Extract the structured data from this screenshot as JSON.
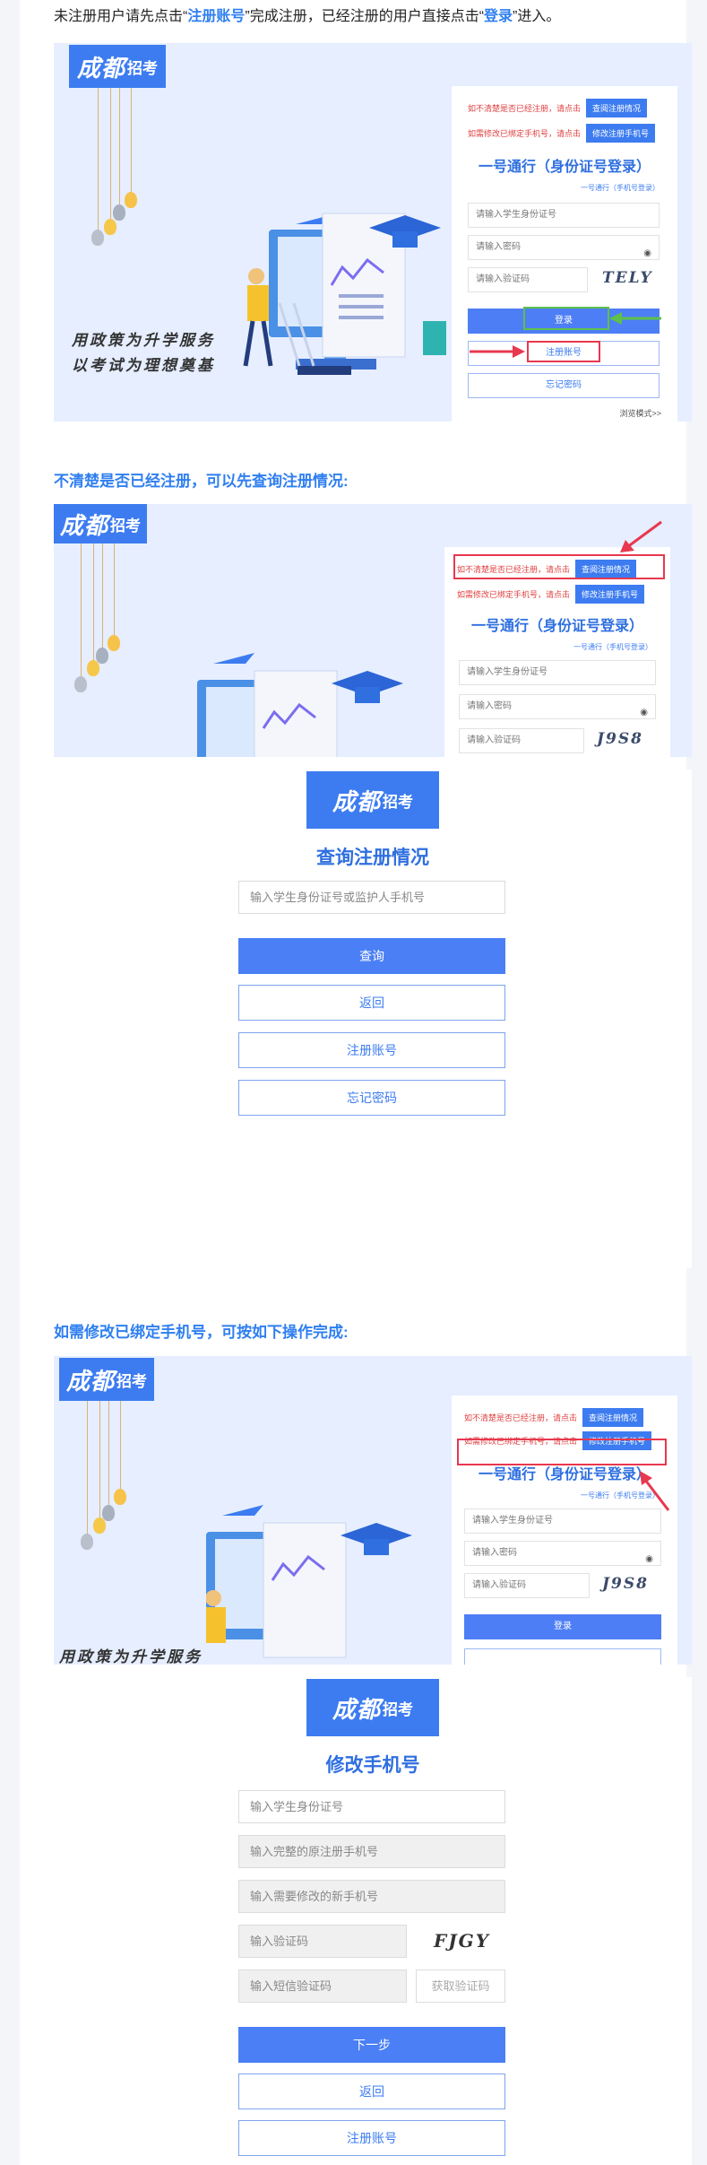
{
  "intro": {
    "before": "未注册用户请先点击“",
    "register": "注册账号",
    "middle": "”完成注册，已经注册的用户直接点击“",
    "login": "登录",
    "after": "”进入。"
  },
  "section2_heading": "不清楚是否已经注册，可以先查询注册情况:",
  "section3_heading": "如需修改已绑定手机号，可按如下操作完成:",
  "logo": {
    "big": "成都",
    "small": "招考"
  },
  "slogan": [
    "用政策为升学服务",
    "以考试为理想奠基"
  ],
  "slogan_partial": "用政策为升学服务",
  "panel": {
    "check_hint": "如不清楚是否已经注册，请点击",
    "check_btn": "查阅注册情况",
    "phone_hint": "如需修改已绑定手机号，请点击",
    "phone_btn": "修改注册手机号",
    "title": "一号通行（身份证号登录）",
    "sub_link": "一号通行（手机号登录）",
    "id_placeholder": "请输入学生身份证号",
    "pwd_placeholder": "请输入密码",
    "code_placeholder": "请输入验证码",
    "login_btn": "登录",
    "register_btn": "注册账号",
    "forgot_btn": "忘记密码",
    "browse_mode": "浏览模式>>"
  },
  "captchas": [
    "TELY",
    "J9S8",
    "J9S8"
  ],
  "query_form": {
    "title": "查询注册情况",
    "input_placeholder": "输入学生身份证号或监护人手机号",
    "query_btn": "查询",
    "back_btn": "返回",
    "register_btn": "注册账号",
    "forgot_btn": "忘记密码"
  },
  "phone_form": {
    "title": "修改手机号",
    "id_placeholder": "输入学生身份证号",
    "old_phone_placeholder": "输入完整的原注册手机号",
    "new_phone_placeholder": "输入需要修改的新手机号",
    "code_placeholder": "输入验证码",
    "captcha": "FJGY",
    "sms_placeholder": "输入短信验证码",
    "get_code": "获取验证码",
    "next_btn": "下一步",
    "back_btn": "返回",
    "register_btn": "注册账号"
  },
  "colors": {
    "accent": "#2f7ff0",
    "button": "#4a7ff5",
    "highlight": "#e8384f",
    "arrow_green": "#5dc04a"
  }
}
